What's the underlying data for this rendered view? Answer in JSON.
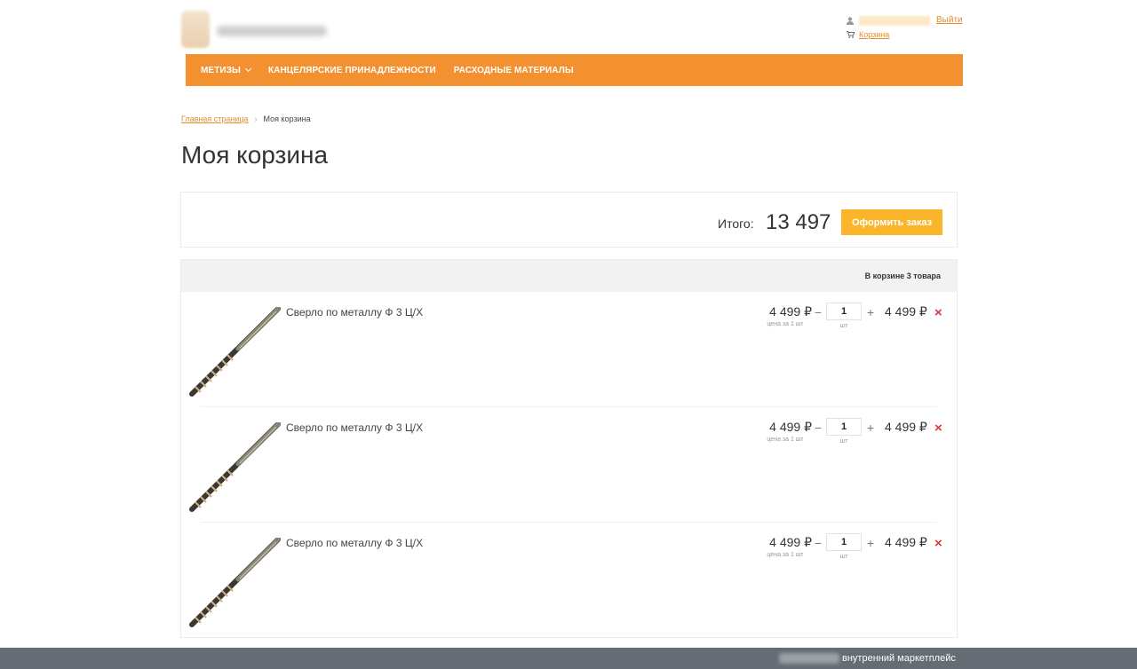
{
  "header": {
    "logout_label": "Выйти",
    "cart_label": "Корзина"
  },
  "nav": {
    "items": [
      {
        "label": "МЕТИЗЫ"
      },
      {
        "label": "КАНЦЕЛЯРСКИЕ ПРИНАДЛЕЖНОСТИ"
      },
      {
        "label": "РАСХОДНЫЕ МАТЕРИАЛЫ"
      }
    ]
  },
  "breadcrumb": {
    "home": "Главная страница",
    "separator": "›",
    "current": "Моя корзина"
  },
  "page_title": "Моя корзина",
  "summary": {
    "total_label": "Итого:",
    "total_value": "13 497",
    "order_button": "Оформить заказ"
  },
  "cart": {
    "count_label": "В корзине 3 товара",
    "items": [
      {
        "name": "Сверло по металлу Ф 3 Ц/Х",
        "price": "4 499 ₽",
        "price_note": "цена за 1 шт",
        "qty": "1",
        "unit": "шт",
        "sum": "4 499 ₽"
      },
      {
        "name": "Сверло по металлу Ф 3 Ц/Х",
        "price": "4 499 ₽",
        "price_note": "цена за 1 шт",
        "qty": "1",
        "unit": "шт",
        "sum": "4 499 ₽"
      },
      {
        "name": "Сверло по металлу Ф 3 Ц/Х",
        "price": "4 499 ₽",
        "price_note": "цена за 1 шт",
        "qty": "1",
        "unit": "шт",
        "sum": "4 499 ₽"
      }
    ],
    "minus": "−",
    "plus": "+",
    "remove": "×"
  },
  "footer": {
    "text": "внутренний маркетплейс"
  },
  "colors": {
    "nav_bg": "#f39131",
    "accent_link": "#e38d2c",
    "order_button": "#fbb52a",
    "remove": "#e2333c",
    "footer_bg": "#666c74"
  }
}
